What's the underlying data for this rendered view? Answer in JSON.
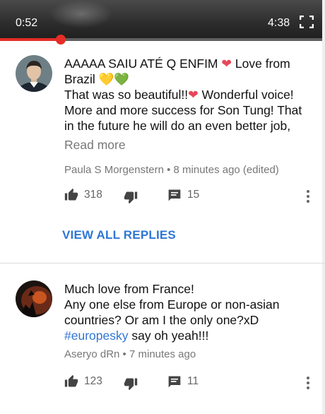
{
  "player": {
    "current_time": "0:52",
    "duration": "4:38",
    "progress": 0.187,
    "icon": "fullscreen-icon",
    "accent_color": "#e52d27"
  },
  "comments": [
    {
      "text_lines": [
        {
          "text": "AAAAA SAIU  ATÉ Q ENFIM ",
          "emoji": "❤",
          "after": " Love from"
        },
        {
          "text": "Brazil ",
          "emoji": "💛💚"
        },
        {
          "text": "That was so beautiful!!",
          "emoji": "❤",
          "after": " Wonderful voice!"
        },
        {
          "text": "More and more success for Son Tung! That"
        },
        {
          "text": "in the future he will do an even better job,"
        }
      ],
      "read_more": "Read more",
      "author": "Paula S Morgenstern",
      "separator": "•",
      "time": "8 minutes ago (edited)",
      "likes": "318",
      "replies": "15",
      "view_replies": "VIEW ALL REPLIES"
    },
    {
      "text_lines": [
        {
          "text": "Much love from France!"
        },
        {
          "text": "Any one else from Europe or non-asian"
        },
        {
          "text": "countries? Or am I the only one?xD"
        },
        {
          "hashtag": "#europesky",
          "after": " say oh yeah!!!"
        }
      ],
      "author": "Aseryo dRn",
      "separator": "•",
      "time": "7 minutes ago",
      "likes": "123",
      "replies": "11"
    }
  ],
  "icons": {
    "like": "thumbs-up-icon",
    "dislike": "thumbs-down-icon",
    "reply": "reply-comment-icon",
    "more": "more-vertical-icon"
  },
  "colors": {
    "link": "#2f76d4",
    "meta_text": "#777777",
    "progress": "#e52d27"
  }
}
